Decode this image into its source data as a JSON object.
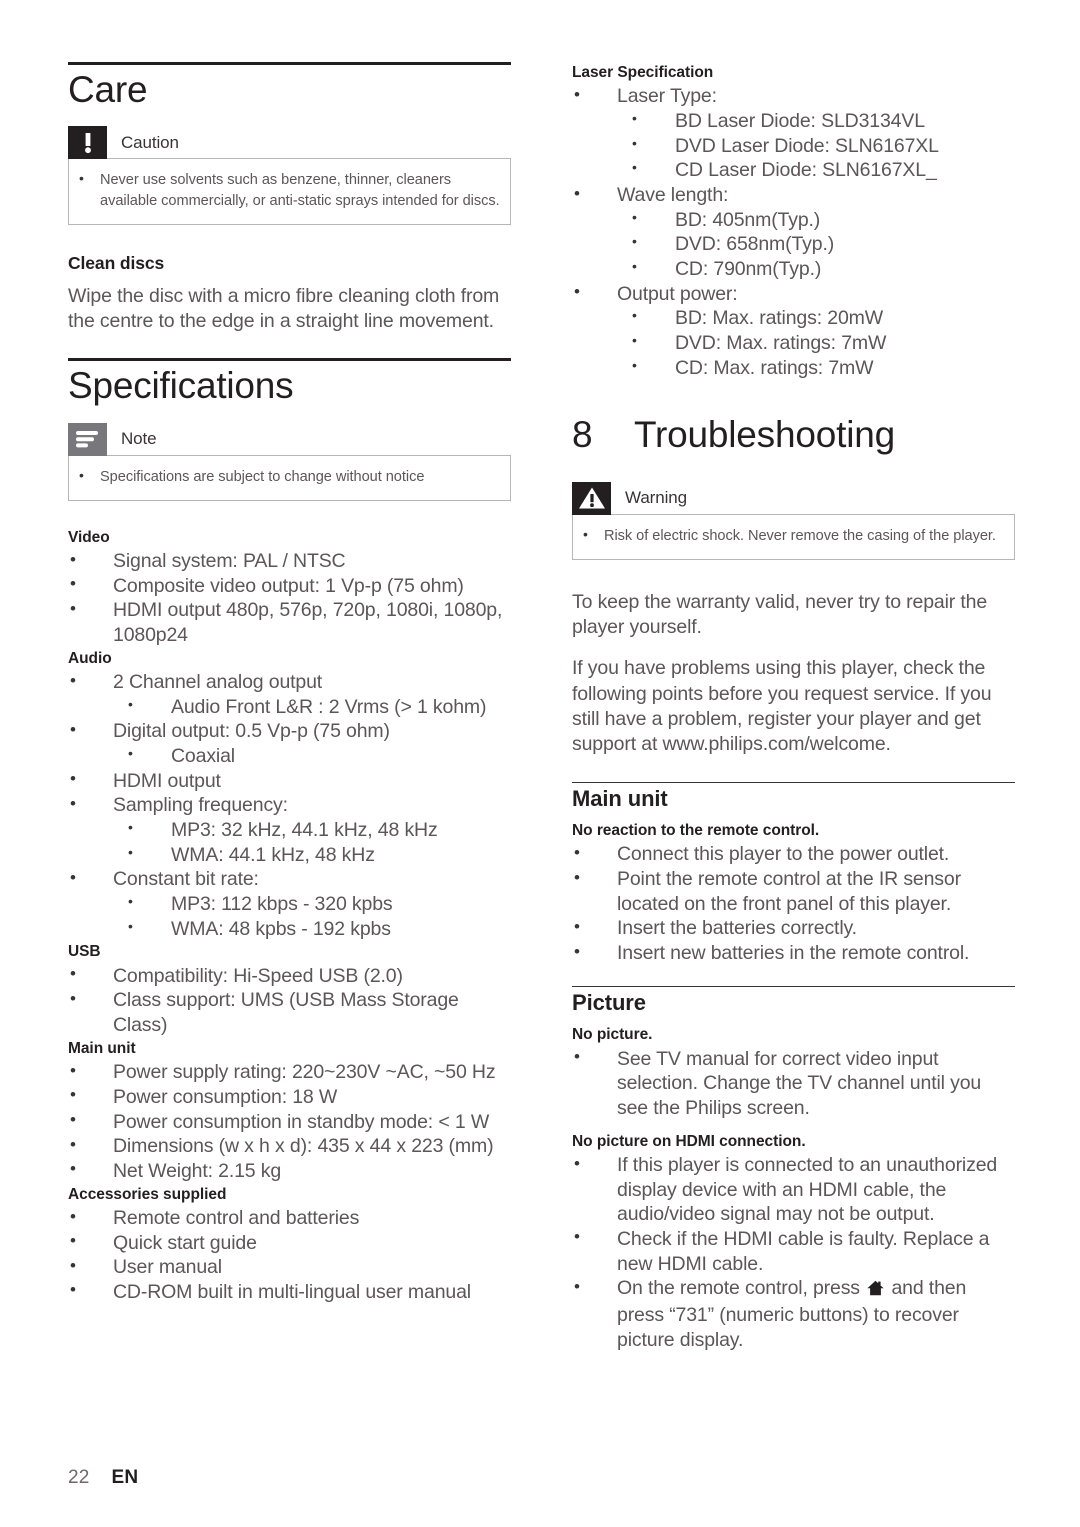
{
  "document": {
    "footer": {
      "page_number": "22",
      "language": "EN"
    }
  },
  "left_column": {
    "care": {
      "title": "Care",
      "caution": {
        "label": "Caution",
        "icon": "exclamation-mark-icon",
        "items": [
          "Never use solvents such as benzene, thinner, cleaners available commercially, or anti-static sprays intended for discs."
        ]
      },
      "clean_discs": {
        "heading": "Clean discs",
        "body": "Wipe the disc with a micro fibre cleaning cloth from the centre to the edge in a straight line movement."
      }
    },
    "specifications": {
      "title": "Specifications",
      "note": {
        "label": "Note",
        "icon": "note-lines-icon",
        "items": [
          "Specifications are subject to change without notice"
        ]
      },
      "groups": [
        {
          "heading": "Video",
          "items": [
            {
              "text": "Signal system: PAL / NTSC"
            },
            {
              "text": "Composite video output: 1 Vp-p (75 ohm)"
            },
            {
              "text": "HDMI output 480p, 576p, 720p, 1080i, 1080p, 1080p24"
            }
          ]
        },
        {
          "heading": "Audio",
          "items": [
            {
              "text": "2 Channel analog output",
              "children": [
                "Audio Front L&R : 2 Vrms (> 1 kohm)"
              ]
            },
            {
              "text": "Digital output: 0.5 Vp-p (75 ohm)",
              "children": [
                "Coaxial"
              ]
            },
            {
              "text": "HDMI output"
            },
            {
              "text": "Sampling frequency:",
              "children": [
                "MP3: 32 kHz, 44.1 kHz, 48 kHz",
                "WMA: 44.1 kHz, 48 kHz"
              ]
            },
            {
              "text": "Constant bit rate:",
              "children": [
                "MP3: 112 kbps - 320 kpbs",
                "WMA: 48 kpbs - 192 kpbs"
              ]
            }
          ]
        },
        {
          "heading": "USB",
          "items": [
            {
              "text": "Compatibility: Hi-Speed USB (2.0)"
            },
            {
              "text": "Class support: UMS (USB Mass Storage Class)"
            }
          ]
        },
        {
          "heading": "Main unit",
          "items": [
            {
              "text": "Power supply rating: 220~230V ~AC, ~50 Hz"
            },
            {
              "text": "Power consumption: 18 W"
            },
            {
              "text": "Power consumption in standby mode: < 1 W"
            },
            {
              "text": "Dimensions (w x h x d): 435 x 44 x 223 (mm)"
            },
            {
              "text": "Net Weight: 2.15 kg"
            }
          ]
        },
        {
          "heading": "Accessories supplied",
          "items": [
            {
              "text": "Remote control and batteries"
            },
            {
              "text": "Quick start guide"
            },
            {
              "text": "User manual"
            },
            {
              "text": "CD-ROM built in multi-lingual user manual"
            }
          ]
        }
      ]
    }
  },
  "right_column": {
    "laser_specification": {
      "heading": "Laser Specification",
      "items": [
        {
          "text": "Laser Type:",
          "children": [
            "BD Laser Diode: SLD3134VL",
            "DVD Laser Diode: SLN6167XL",
            "CD Laser Diode: SLN6167XL_"
          ]
        },
        {
          "text": "Wave length:",
          "children": [
            "BD: 405nm(Typ.)",
            "DVD: 658nm(Typ.)",
            "CD: 790nm(Typ.)"
          ]
        },
        {
          "text": "Output power:",
          "children": [
            "BD: Max. ratings: 20mW",
            "DVD: Max. ratings: 7mW",
            "CD: Max. ratings: 7mW"
          ]
        }
      ]
    },
    "troubleshooting": {
      "chapter_number": "8",
      "title": "Troubleshooting",
      "warning": {
        "label": "Warning",
        "icon": "warning-triangle-icon",
        "items": [
          "Risk of electric shock. Never remove the casing of the player."
        ]
      },
      "intro_paragraphs": [
        "To keep the warranty valid, never try to repair the player yourself.",
        "If you have problems using this player, check the following points before you request service. If you still have a problem, register your player and get support at www.philips.com/welcome."
      ],
      "main_unit": {
        "title": "Main unit",
        "problems": [
          {
            "heading": "No reaction to the remote control.",
            "items": [
              "Connect this player to the power outlet.",
              "Point the remote control at the IR sensor located on the front panel of this player.",
              "Insert the batteries correctly.",
              "Insert new batteries in the remote control."
            ]
          }
        ]
      },
      "picture": {
        "title": "Picture",
        "problems": [
          {
            "heading": "No picture.",
            "items": [
              "See TV manual for correct video input selection. Change the TV channel until you see the Philips screen."
            ]
          },
          {
            "heading": "No picture on HDMI connection.",
            "items": [
              "If this player is connected to an unauthorized display device with an HDMI cable, the audio/video signal may not be output.",
              "Check if the HDMI cable is faulty. Replace a new HDMI cable."
            ],
            "items_with_icon": [
              {
                "before": "On the remote control, press ",
                "icon": "home-icon",
                "after": " and then press “731” (numeric buttons) to recover picture display."
              }
            ]
          }
        ]
      }
    }
  }
}
